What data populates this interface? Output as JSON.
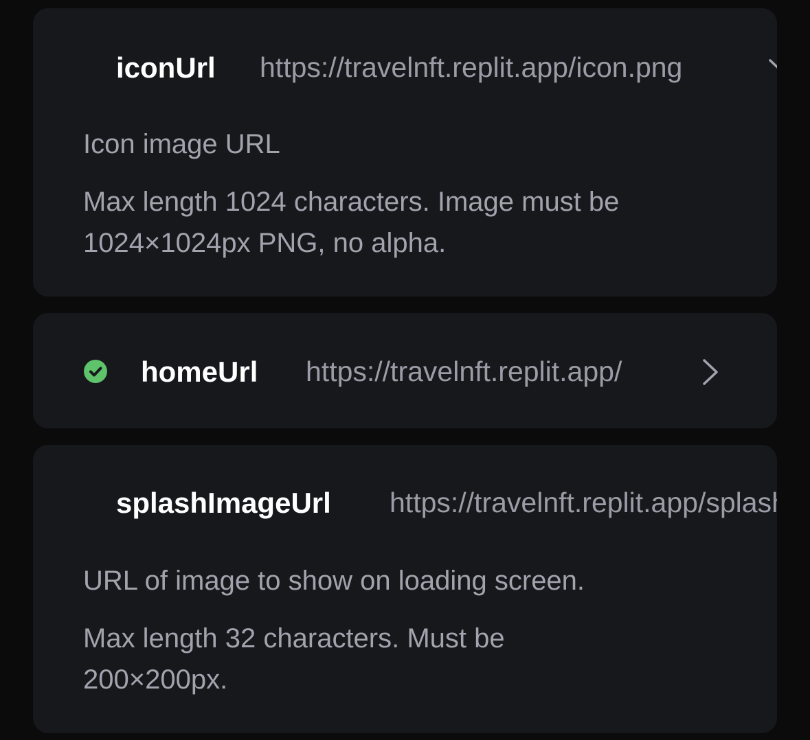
{
  "fields": [
    {
      "name": "iconUrl",
      "value": "https://travelnft.replit.app/icon.png",
      "description": "Icon image URL",
      "constraint": "Max length 1024 characters. Image must be 1024×1024px PNG, no alpha.",
      "chevron": "chevron-down-icon",
      "expanded": true
    },
    {
      "name": "homeUrl",
      "value": "https://travelnft.replit.app/",
      "status_icon": "check-circle-icon",
      "status_color": "#5ec36a",
      "chevron": "chevron-right-icon",
      "expanded": false
    },
    {
      "name": "splashImageUrl",
      "value": "https://travelnft.replit.app/splash.png",
      "description": "URL of image to show on loading screen.",
      "constraint": "Max length 32 characters. Must be 200×200px.",
      "expanded": true
    }
  ],
  "colors": {
    "background": "#0b0b0c",
    "card": "#17181c",
    "name_text": "#ffffff",
    "value_text": "#9a9ca6",
    "description_text": "#a1a3ad",
    "success": "#5ec36a"
  }
}
